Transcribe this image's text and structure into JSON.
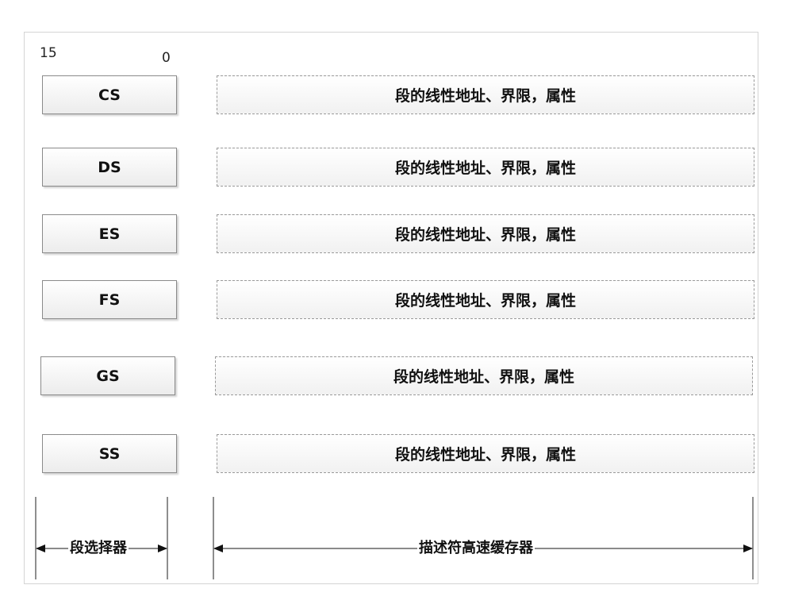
{
  "bit_labels": {
    "high": "15",
    "low": "0"
  },
  "rows": [
    {
      "register": "CS",
      "cache": "段的线性地址、界限，属性"
    },
    {
      "register": "DS",
      "cache": "段的线性地址、界限，属性"
    },
    {
      "register": "ES",
      "cache": "段的线性地址、界限，属性"
    },
    {
      "register": "FS",
      "cache": "段的线性地址、界限，属性"
    },
    {
      "register": "GS",
      "cache": "段的线性地址、界限，属性"
    },
    {
      "register": "SS",
      "cache": "段的线性地址、界限，属性"
    }
  ],
  "dimensions": {
    "selector_label": "段选择器",
    "cache_label": "描述符高速缓存器"
  }
}
